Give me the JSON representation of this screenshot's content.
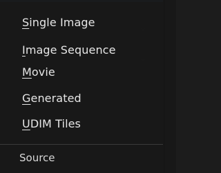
{
  "menu": {
    "title": "Source",
    "items": [
      {
        "label_first": "S",
        "label_rest": "ingle Image"
      },
      {
        "label_first": "I",
        "label_rest": "mage Sequence"
      },
      {
        "label_first": "M",
        "label_rest": "ovie"
      },
      {
        "label_first": "G",
        "label_rest": "enerated"
      },
      {
        "label_first": "U",
        "label_rest": "DIM Tiles"
      }
    ]
  }
}
